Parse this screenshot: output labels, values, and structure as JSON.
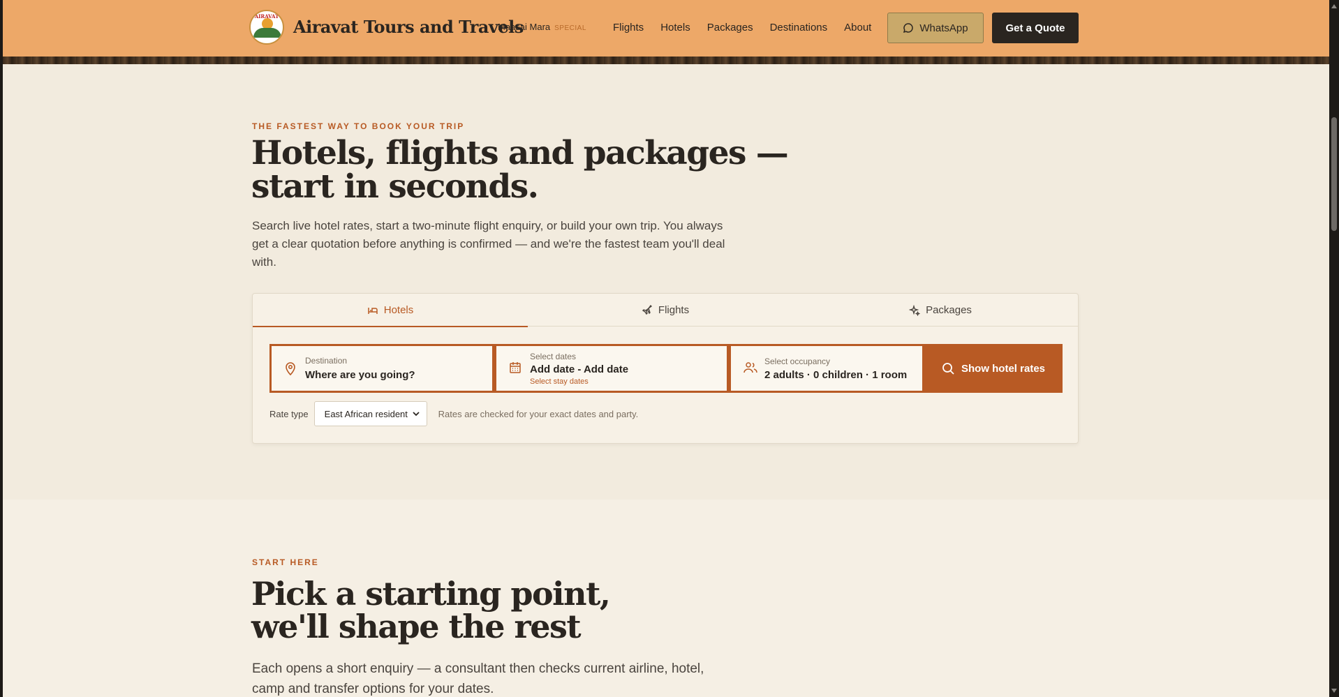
{
  "header": {
    "brand": "Airavat Tours and Travels",
    "logo_text": "AIRAVAT",
    "special_name": "Maasai Mara",
    "special_tag": "SPECIAL",
    "nav": [
      "Flights",
      "Hotels",
      "Packages",
      "Destinations",
      "About"
    ],
    "whatsapp_label": "WhatsApp",
    "quote_label": "Get a Quote"
  },
  "hero": {
    "eyebrow": "THE FASTEST WAY TO BOOK YOUR TRIP",
    "title": "Hotels, flights and packages — start in seconds.",
    "lede": "Search live hotel rates, start a two-minute flight enquiry, or build your own trip. You always get a clear quotation before anything is confirmed — and we're the fastest team you'll deal with."
  },
  "search": {
    "tabs": [
      {
        "label": "Hotels",
        "icon": "bed-icon",
        "active": true
      },
      {
        "label": "Flights",
        "icon": "plane-icon",
        "active": false
      },
      {
        "label": "Packages",
        "icon": "sparkle-icon",
        "active": false
      }
    ],
    "destination": {
      "label": "Destination",
      "placeholder": "Where are you going?"
    },
    "dates": {
      "label": "Select dates",
      "value": "Add date - Add date",
      "hint": "Select stay dates"
    },
    "occupancy": {
      "label": "Select occupancy",
      "value": "2 adults · 0 children · 1 room"
    },
    "submit_label": "Show hotel rates",
    "rate_type_label": "Rate type",
    "rate_type_value": "East African resident",
    "rate_note": "Rates are checked for your exact dates and party."
  },
  "section2": {
    "eyebrow": "START HERE",
    "title": "Pick a starting point, we'll shape the rest",
    "lede": "Each opens a short enquiry — a consultant then checks current airline, hotel, camp and transfer options for your dates."
  },
  "colors": {
    "header_bg": "#eda868",
    "accent": "#b85a24",
    "dark": "#2a2520",
    "page_bg": "#f2ebde"
  }
}
